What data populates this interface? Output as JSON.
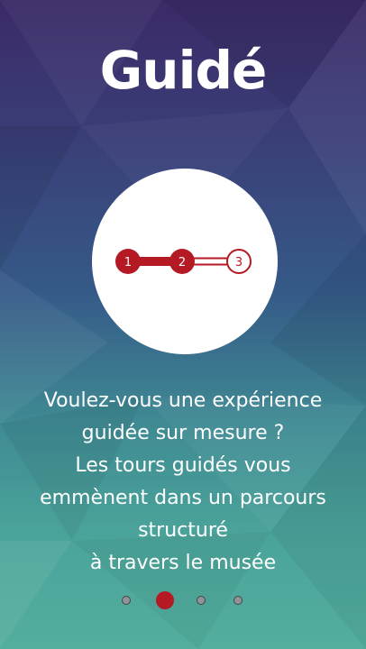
{
  "screen": {
    "title": "Guidé",
    "description": "Voulez-vous une expérience\nguidée sur mesure ?\nLes tours guidés vous\nemmènent dans un parcours\nstructuré\nà travers le musée"
  },
  "stepper": {
    "steps": [
      "1",
      "2",
      "3"
    ],
    "completed_steps": 2,
    "accent_color": "#b51a24"
  },
  "pager": {
    "page_count": 4,
    "current_page": 2,
    "active_color": "#b51a24",
    "inactive_color": "#8e9497"
  }
}
